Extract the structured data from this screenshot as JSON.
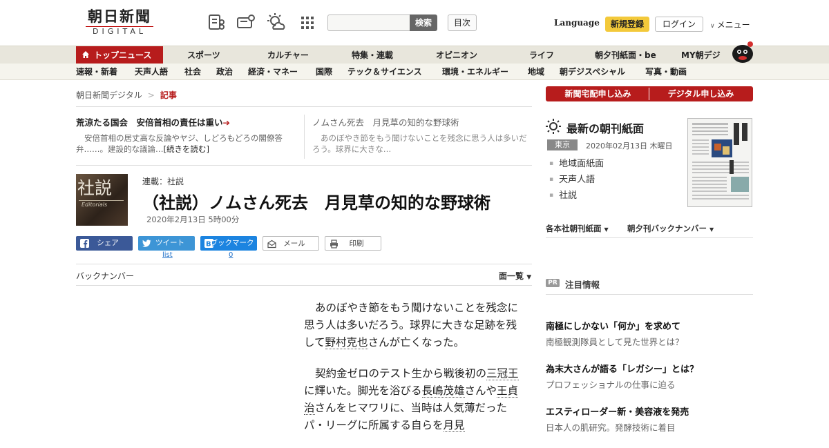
{
  "header": {
    "logo_main": "朝日新聞",
    "logo_sub": "DIGITAL",
    "search_button": "検索",
    "toc_button": "目次",
    "language": "Language",
    "register": "新規登録",
    "login": "ログイン",
    "menu": "メニュー"
  },
  "nav_main": [
    "トップニュース",
    "スポーツ",
    "カルチャー",
    "特集・連載",
    "オピニオン",
    "ライフ",
    "朝夕刊紙面・be",
    "MY朝デジ"
  ],
  "nav_sub": [
    "速報・新着",
    "天声人語",
    "社会",
    "政治",
    "経済・マネー",
    "国際",
    "テック＆サイエンス",
    "環境・エネルギー",
    "地域",
    "朝デジスペシャル",
    "写真・動画"
  ],
  "breadcrumb": {
    "home": "朝日新聞デジタル",
    "sep": ">",
    "current": "記事"
  },
  "featured": [
    {
      "title": "荒涼たる国会　安倍首相の責任は重い",
      "arrow": "➔",
      "body": "安倍首相の居丈高な反論やヤジ、しどろもどろの閣僚答弁……。建設的な議論…",
      "more": "[続きを読む]"
    },
    {
      "title": "ノムさん死去　月見草の知的な野球術",
      "body": "あのぼやき節をもう聞けないことを残念に思う人は多いだろう。球界に大きな…"
    }
  ],
  "article": {
    "thumb_kanji": "社説",
    "thumb_en": "Editorials",
    "series": "連載：社説",
    "title": "（社説）ノムさん死去　月見草の知的な野球術",
    "date": "2020年2月13日 5時00分",
    "share": {
      "facebook": "シェア",
      "twitter": "ツイート",
      "hatena": "ブックマーク",
      "mail": "メール",
      "print": "印刷",
      "twitter_count": "list",
      "hatena_count": "0"
    },
    "back_number": "バックナンバー",
    "page_list": "面一覧",
    "p1": [
      "あのぼやき節をもう聞けないことを残念に思う人は多いだろう。球界に大きな足跡を残して",
      "野村克也",
      "さんが亡くなった。"
    ],
    "p2": [
      "契約金ゼロのテスト生から戦後初の",
      "三冠王",
      "に輝いた。脚光を浴びる",
      "長嶋茂雄",
      "さんや",
      "王貞治",
      "さんをヒマワリに、当時は人気薄だったパ・リーグに所属する自らを",
      "月見"
    ]
  },
  "sidebar": {
    "sub_paper": "新聞宅配申し込み",
    "sub_digital": "デジタル申し込み",
    "paper_title": "最新の朝刊紙面",
    "region": "東京",
    "paper_date": "2020年02月13日 木曜日",
    "paper_links": [
      "地域面紙面",
      "天声人語",
      "社説"
    ],
    "dropdown1": "各本社朝刊紙面",
    "dropdown2": "朝夕刊バックナンバー",
    "pr_badge": "PR",
    "pr_title": "注目情報",
    "pr_items": [
      {
        "title": "南極にしかない「何か」を求めて",
        "sub": "南極観測隊員として見た世界とは？"
      },
      {
        "title": "為末大さんが語る「レガシー」とは？",
        "sub": "プロフェッショナルの仕事に迫る"
      },
      {
        "title": "エスティローダー新・美容液を発売",
        "sub": "日本人の肌研究。発酵技術に着目"
      }
    ]
  }
}
